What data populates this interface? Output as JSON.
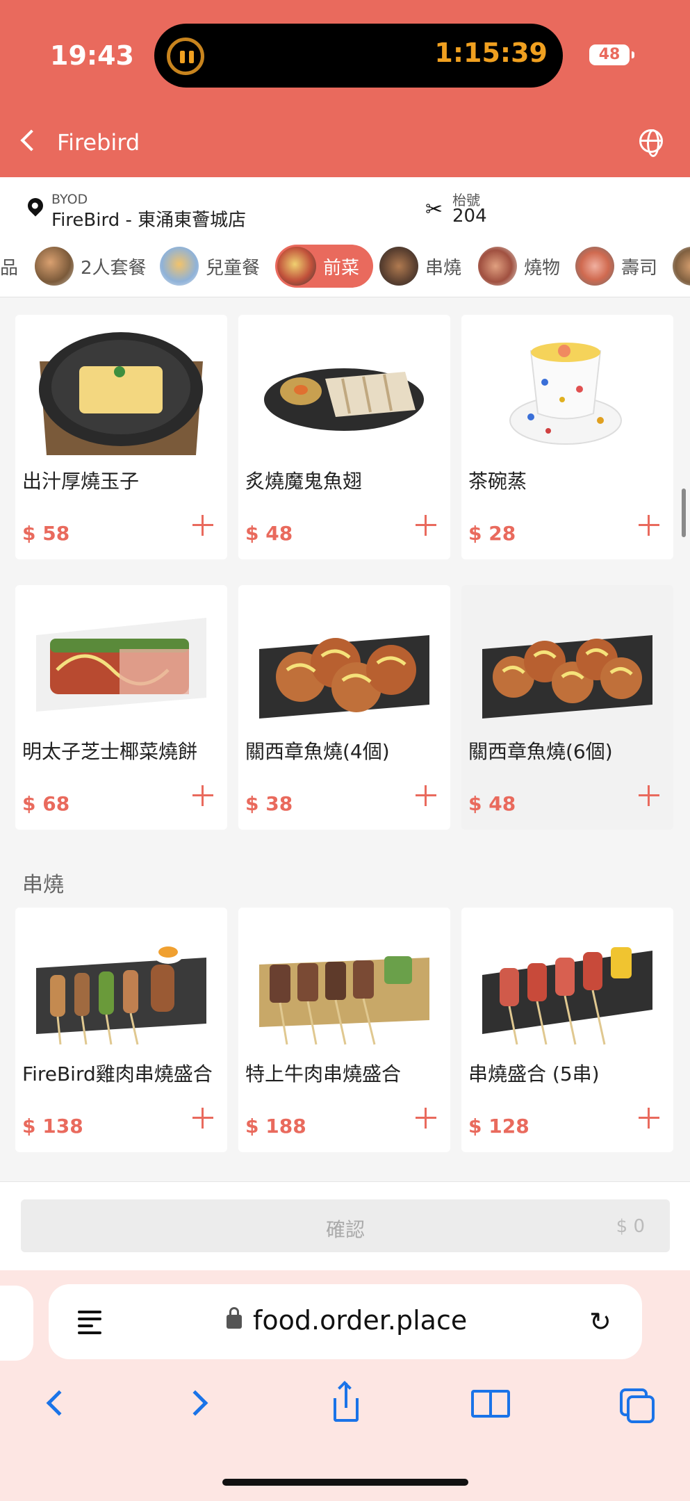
{
  "status": {
    "time": "19:43",
    "timer": "1:15:39",
    "battery": "48"
  },
  "header": {
    "title": "Firebird"
  },
  "info": {
    "byod_label": "BYOD",
    "store": "FireBird - 東涌東薈城店",
    "table_label": "枱號",
    "table_no": "204"
  },
  "categories": [
    {
      "label": "品"
    },
    {
      "label": "2人套餐"
    },
    {
      "label": "兒童餐"
    },
    {
      "label": "前菜",
      "active": true
    },
    {
      "label": "串燒"
    },
    {
      "label": "燒物"
    },
    {
      "label": "壽司"
    }
  ],
  "sections": [
    {
      "title": ""
    },
    {
      "title": "串燒"
    }
  ],
  "products": [
    {
      "name": "出汁厚燒玉子",
      "price": "$ 58"
    },
    {
      "name": "炙燒魔鬼魚翅",
      "price": "$ 48"
    },
    {
      "name": "茶碗蒸",
      "price": "$ 28"
    },
    {
      "name": "明太子芝士椰菜燒餅",
      "price": "$ 68"
    },
    {
      "name": "關西章魚燒(4個)",
      "price": "$ 38"
    },
    {
      "name": "關西章魚燒(6個)",
      "price": "$ 48"
    },
    {
      "name": "FireBird雞肉串燒盛合",
      "price": "$ 138"
    },
    {
      "name": "特上牛肉串燒盛合",
      "price": "$ 188"
    },
    {
      "name": "串燒盛合 (5串)",
      "price": "$ 128"
    }
  ],
  "confirm": {
    "label": "確認",
    "total": "$ 0"
  },
  "browser": {
    "url": "food.order.place"
  },
  "colors": {
    "accent": "#e96a5d",
    "browser_blue": "#1a73e8"
  }
}
